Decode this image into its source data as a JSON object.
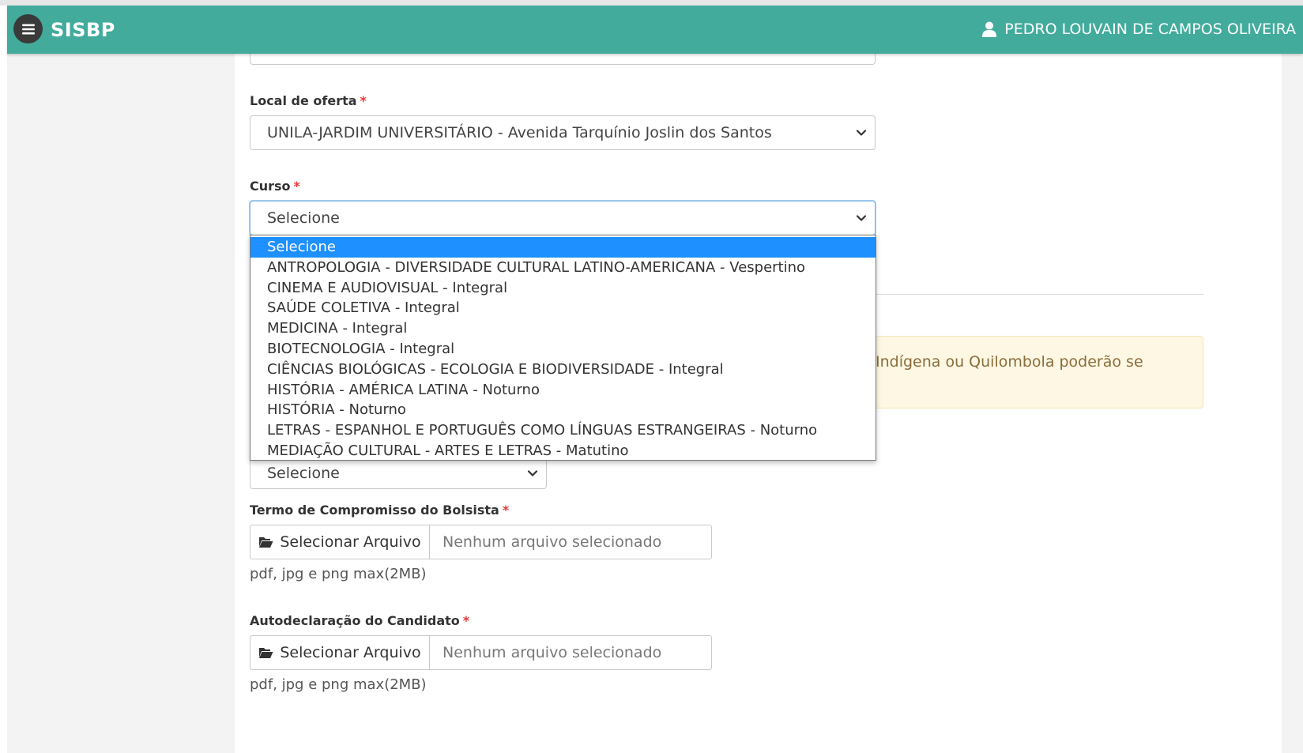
{
  "app": {
    "brand": "SISBP",
    "user_name": "PEDRO LOUVAIN DE CAMPOS OLIVEIRA"
  },
  "form": {
    "local_oferta": {
      "label": "Local de oferta",
      "required_mark": "*",
      "value": "UNILA-JARDIM UNIVERSITÁRIO - Avenida Tarquínio Joslin dos Santos"
    },
    "curso": {
      "label": "Curso",
      "required_mark": "*",
      "value": "Selecione",
      "options": [
        "Selecione",
        "ANTROPOLOGIA - DIVERSIDADE CULTURAL LATINO-AMERICANA - Vespertino",
        "CINEMA E AUDIOVISUAL - Integral",
        "SAÚDE COLETIVA - Integral",
        "MEDICINA - Integral",
        "BIOTECNOLOGIA - Integral",
        "CIÊNCIAS BIOLÓGICAS - ECOLOGIA E BIODIVERSIDADE - Integral",
        "HISTÓRIA - AMÉRICA LATINA - Noturno",
        "HISTÓRIA - Noturno",
        "LETRAS - ESPANHOL E PORTUGUÊS COMO LÍNGUAS ESTRANGEIRAS - Noturno",
        "MEDIAÇÃO CULTURAL - ARTES E LETRAS - Matutino"
      ]
    },
    "alert_text": "Indígena ou Quilombola poderão se",
    "small_select_value": "Selecione",
    "termo": {
      "label": "Termo de Compromisso do Bolsista",
      "required_mark": "*",
      "button_label": "Selecionar Arquivo",
      "file_placeholder": "Nenhum arquivo selecionado",
      "help": "pdf, jpg e png max(2MB)"
    },
    "autodeclaracao": {
      "label": "Autodeclaração do Candidato",
      "required_mark": "*",
      "button_label": "Selecionar Arquivo",
      "file_placeholder": "Nenhum arquivo selecionado",
      "help": "pdf, jpg e png max(2MB)"
    }
  },
  "colors": {
    "header": "#42ab9c",
    "selected_option": "#1e90ff",
    "required": "#e53935",
    "alert_bg": "#fdf7e3"
  }
}
